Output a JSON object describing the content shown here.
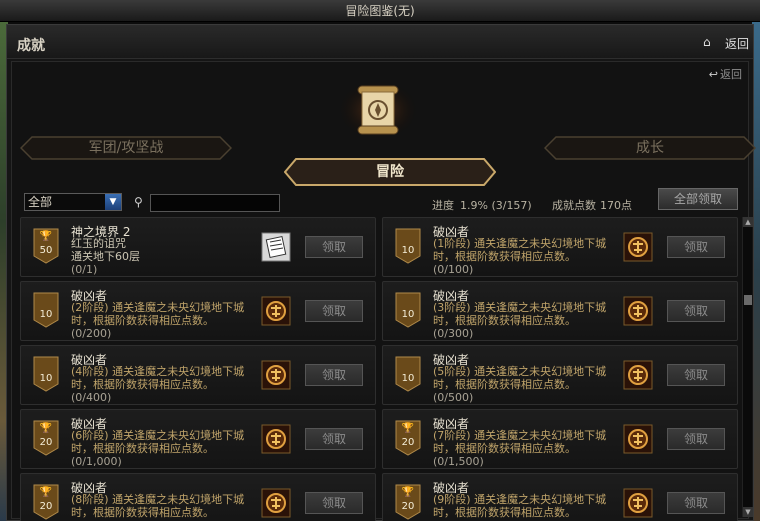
{
  "titlebar": {
    "title": "冒险图鉴(无)"
  },
  "header": {
    "title": "成就",
    "back_label": "返回"
  },
  "panel": {
    "back_label": "返回"
  },
  "tabs": [
    {
      "label": "军团/攻坚战"
    },
    {
      "label": "冒险"
    },
    {
      "label": "成长"
    }
  ],
  "filter": {
    "selected": "全部",
    "search_value": ""
  },
  "stats": {
    "progress_label": "进度",
    "progress_value": "1.9% (3/157)",
    "points_label": "成就点数",
    "points_value": "170点"
  },
  "claim_all_label": "全部领取",
  "cards": [
    {
      "title": "神之境界 2",
      "desc": "红玉的诅咒\n通关地下60层",
      "progress": "(0/1)",
      "level": "50",
      "cup": true,
      "reward": "scroll",
      "claim": "领取"
    },
    {
      "title": "破凶者",
      "desc": "(1阶段) 通关逢魔之未央幻境地下城时，根据阶数获得相应点数。",
      "progress": "(0/100)",
      "level": "10",
      "cup": false,
      "reward": "emblem",
      "claim": "领取"
    },
    {
      "title": "破凶者",
      "desc": "(2阶段) 通关逢魔之未央幻境地下城时，根据阶数获得相应点数。",
      "progress": "(0/200)",
      "level": "10",
      "cup": false,
      "reward": "emblem",
      "claim": "领取"
    },
    {
      "title": "破凶者",
      "desc": "(3阶段) 通关逢魔之未央幻境地下城时，根据阶数获得相应点数。",
      "progress": "(0/300)",
      "level": "10",
      "cup": false,
      "reward": "emblem",
      "claim": "领取"
    },
    {
      "title": "破凶者",
      "desc": "(4阶段) 通关逢魔之未央幻境地下城时，根据阶数获得相应点数。",
      "progress": "(0/400)",
      "level": "10",
      "cup": false,
      "reward": "emblem",
      "claim": "领取"
    },
    {
      "title": "破凶者",
      "desc": "(5阶段) 通关逢魔之未央幻境地下城时，根据阶数获得相应点数。",
      "progress": "(0/500)",
      "level": "10",
      "cup": false,
      "reward": "emblem",
      "claim": "领取"
    },
    {
      "title": "破凶者",
      "desc": "(6阶段) 通关逢魔之未央幻境地下城时，根据阶数获得相应点数。",
      "progress": "(0/1,000)",
      "level": "20",
      "cup": true,
      "reward": "emblem",
      "claim": "领取"
    },
    {
      "title": "破凶者",
      "desc": "(7阶段) 通关逢魔之未央幻境地下城时，根据阶数获得相应点数。",
      "progress": "(0/1,500)",
      "level": "20",
      "cup": true,
      "reward": "emblem",
      "claim": "领取"
    },
    {
      "title": "破凶者",
      "desc": "(8阶段) 通关逢魔之未央幻境地下城时，根据阶数获得相应点数。",
      "progress": "(0/2,000)",
      "level": "20",
      "cup": true,
      "reward": "emblem",
      "claim": "领取"
    },
    {
      "title": "破凶者",
      "desc": "(9阶段) 通关逢魔之未央幻境地下城时，根据阶数获得相应点数。",
      "progress": "(0/2,500)",
      "level": "20",
      "cup": true,
      "reward": "emblem",
      "claim": "领取"
    }
  ],
  "colors": {
    "accent": "#c0a46a",
    "badge_gold": "#8a6a2a"
  }
}
